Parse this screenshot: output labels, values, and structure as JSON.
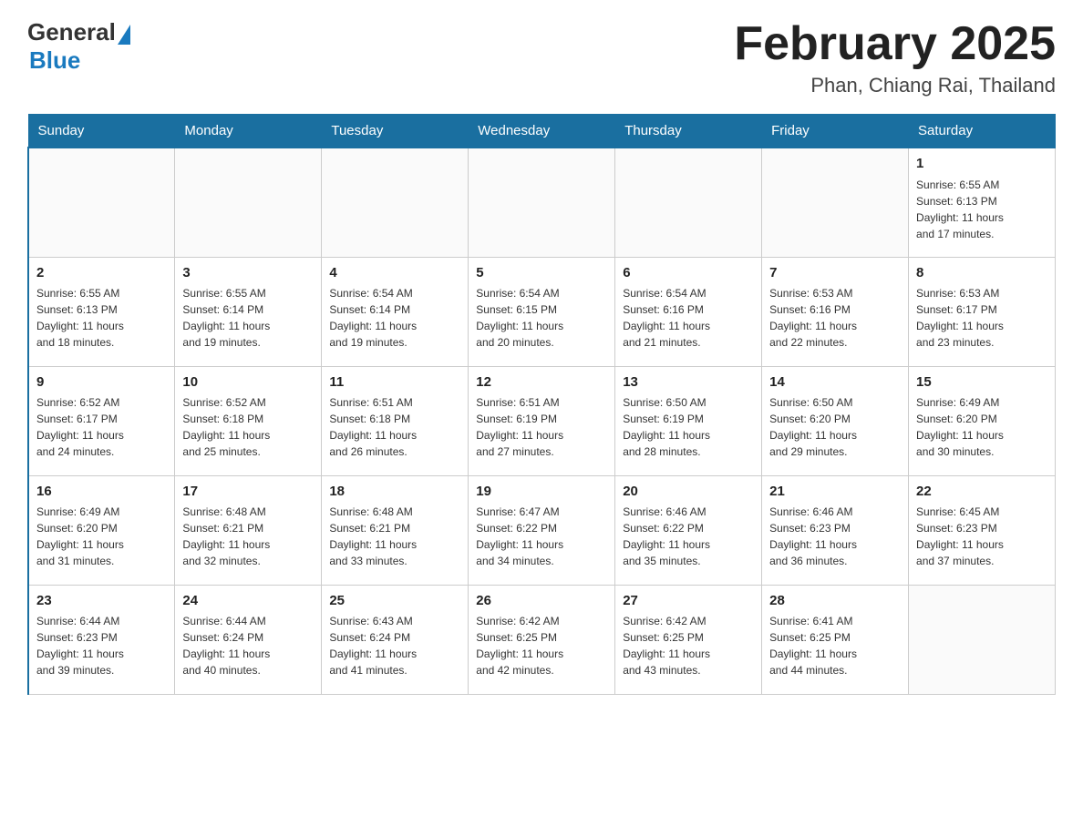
{
  "header": {
    "logo_general": "General",
    "logo_blue": "Blue",
    "month_title": "February 2025",
    "location": "Phan, Chiang Rai, Thailand"
  },
  "weekdays": [
    "Sunday",
    "Monday",
    "Tuesday",
    "Wednesday",
    "Thursday",
    "Friday",
    "Saturday"
  ],
  "weeks": [
    [
      {
        "day": "",
        "info": ""
      },
      {
        "day": "",
        "info": ""
      },
      {
        "day": "",
        "info": ""
      },
      {
        "day": "",
        "info": ""
      },
      {
        "day": "",
        "info": ""
      },
      {
        "day": "",
        "info": ""
      },
      {
        "day": "1",
        "info": "Sunrise: 6:55 AM\nSunset: 6:13 PM\nDaylight: 11 hours\nand 17 minutes."
      }
    ],
    [
      {
        "day": "2",
        "info": "Sunrise: 6:55 AM\nSunset: 6:13 PM\nDaylight: 11 hours\nand 18 minutes."
      },
      {
        "day": "3",
        "info": "Sunrise: 6:55 AM\nSunset: 6:14 PM\nDaylight: 11 hours\nand 19 minutes."
      },
      {
        "day": "4",
        "info": "Sunrise: 6:54 AM\nSunset: 6:14 PM\nDaylight: 11 hours\nand 19 minutes."
      },
      {
        "day": "5",
        "info": "Sunrise: 6:54 AM\nSunset: 6:15 PM\nDaylight: 11 hours\nand 20 minutes."
      },
      {
        "day": "6",
        "info": "Sunrise: 6:54 AM\nSunset: 6:16 PM\nDaylight: 11 hours\nand 21 minutes."
      },
      {
        "day": "7",
        "info": "Sunrise: 6:53 AM\nSunset: 6:16 PM\nDaylight: 11 hours\nand 22 minutes."
      },
      {
        "day": "8",
        "info": "Sunrise: 6:53 AM\nSunset: 6:17 PM\nDaylight: 11 hours\nand 23 minutes."
      }
    ],
    [
      {
        "day": "9",
        "info": "Sunrise: 6:52 AM\nSunset: 6:17 PM\nDaylight: 11 hours\nand 24 minutes."
      },
      {
        "day": "10",
        "info": "Sunrise: 6:52 AM\nSunset: 6:18 PM\nDaylight: 11 hours\nand 25 minutes."
      },
      {
        "day": "11",
        "info": "Sunrise: 6:51 AM\nSunset: 6:18 PM\nDaylight: 11 hours\nand 26 minutes."
      },
      {
        "day": "12",
        "info": "Sunrise: 6:51 AM\nSunset: 6:19 PM\nDaylight: 11 hours\nand 27 minutes."
      },
      {
        "day": "13",
        "info": "Sunrise: 6:50 AM\nSunset: 6:19 PM\nDaylight: 11 hours\nand 28 minutes."
      },
      {
        "day": "14",
        "info": "Sunrise: 6:50 AM\nSunset: 6:20 PM\nDaylight: 11 hours\nand 29 minutes."
      },
      {
        "day": "15",
        "info": "Sunrise: 6:49 AM\nSunset: 6:20 PM\nDaylight: 11 hours\nand 30 minutes."
      }
    ],
    [
      {
        "day": "16",
        "info": "Sunrise: 6:49 AM\nSunset: 6:20 PM\nDaylight: 11 hours\nand 31 minutes."
      },
      {
        "day": "17",
        "info": "Sunrise: 6:48 AM\nSunset: 6:21 PM\nDaylight: 11 hours\nand 32 minutes."
      },
      {
        "day": "18",
        "info": "Sunrise: 6:48 AM\nSunset: 6:21 PM\nDaylight: 11 hours\nand 33 minutes."
      },
      {
        "day": "19",
        "info": "Sunrise: 6:47 AM\nSunset: 6:22 PM\nDaylight: 11 hours\nand 34 minutes."
      },
      {
        "day": "20",
        "info": "Sunrise: 6:46 AM\nSunset: 6:22 PM\nDaylight: 11 hours\nand 35 minutes."
      },
      {
        "day": "21",
        "info": "Sunrise: 6:46 AM\nSunset: 6:23 PM\nDaylight: 11 hours\nand 36 minutes."
      },
      {
        "day": "22",
        "info": "Sunrise: 6:45 AM\nSunset: 6:23 PM\nDaylight: 11 hours\nand 37 minutes."
      }
    ],
    [
      {
        "day": "23",
        "info": "Sunrise: 6:44 AM\nSunset: 6:23 PM\nDaylight: 11 hours\nand 39 minutes."
      },
      {
        "day": "24",
        "info": "Sunrise: 6:44 AM\nSunset: 6:24 PM\nDaylight: 11 hours\nand 40 minutes."
      },
      {
        "day": "25",
        "info": "Sunrise: 6:43 AM\nSunset: 6:24 PM\nDaylight: 11 hours\nand 41 minutes."
      },
      {
        "day": "26",
        "info": "Sunrise: 6:42 AM\nSunset: 6:25 PM\nDaylight: 11 hours\nand 42 minutes."
      },
      {
        "day": "27",
        "info": "Sunrise: 6:42 AM\nSunset: 6:25 PM\nDaylight: 11 hours\nand 43 minutes."
      },
      {
        "day": "28",
        "info": "Sunrise: 6:41 AM\nSunset: 6:25 PM\nDaylight: 11 hours\nand 44 minutes."
      },
      {
        "day": "",
        "info": ""
      }
    ]
  ]
}
